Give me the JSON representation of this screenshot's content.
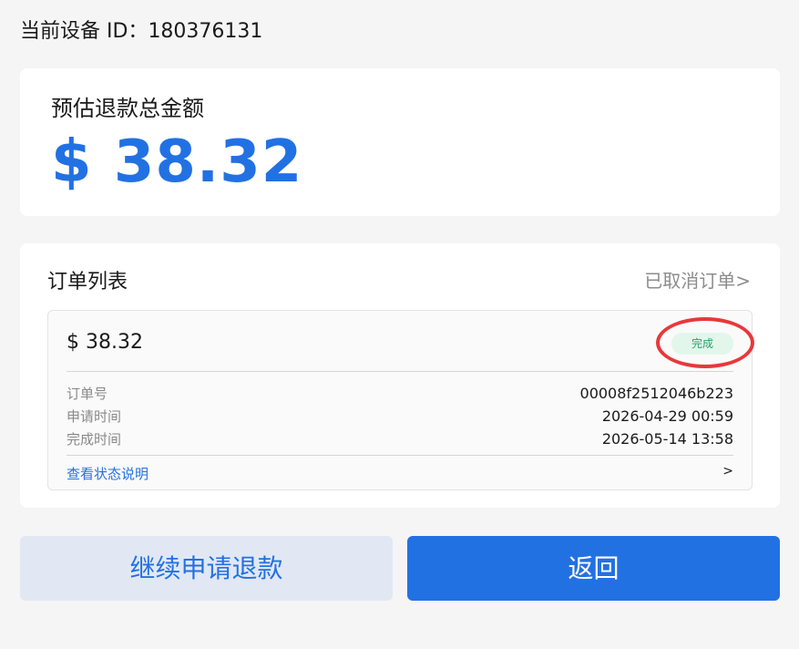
{
  "device": {
    "label": "当前设备 ID：",
    "id": "180376131"
  },
  "summary": {
    "label": "预估退款总金额",
    "amount": "$ 38.32"
  },
  "orders": {
    "title": "订单列表",
    "cancelled_link": "已取消订单>",
    "items": [
      {
        "amount": "$ 38.32",
        "status": "完成",
        "fields": [
          {
            "label": "订单号",
            "value": "00008f2512046b223"
          },
          {
            "label": "申请时间",
            "value": "2026-04-29 00:59"
          },
          {
            "label": "完成时间",
            "value": "2026-05-14 13:58"
          }
        ],
        "status_link": "查看状态说明",
        "status_arrow": ">"
      }
    ]
  },
  "actions": {
    "continue_label": "继续申请退款",
    "back_label": "返回"
  },
  "colors": {
    "accent": "#2271e3",
    "status_complete_bg": "#e2f6ec",
    "status_complete_text": "#2aa06a",
    "highlight_ring": "#e8383a"
  }
}
